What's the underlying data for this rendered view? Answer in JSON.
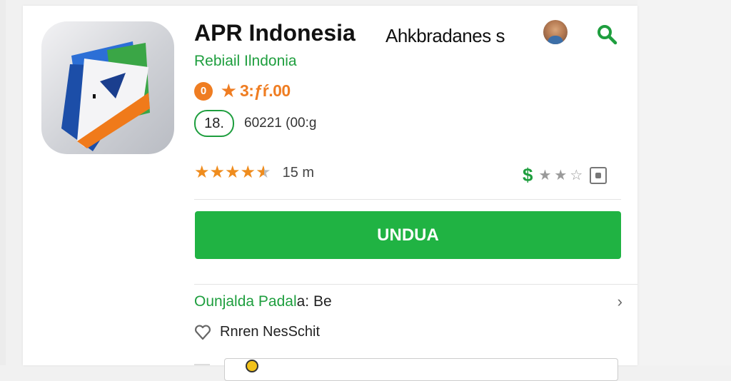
{
  "app": {
    "title": "APR Indonesia",
    "title_suffix": "Ahkbradanes s",
    "developer": "Rebiail Ilndonia",
    "rating_badge": "0",
    "rating_text": "★ 3:ƒŕ.00",
    "age_badge": "18.",
    "size_text": "60221 (00:g",
    "reviews_count": "15 m",
    "install_label": "UNDUA"
  },
  "section": {
    "title_green": "Ounjalda Padal",
    "title_dark": "a: Be",
    "info_text": "Rnren NesSchit"
  },
  "ratings": {
    "filled_stars": 4,
    "half_stars": 1,
    "secondary_stars": 3
  },
  "icons": {
    "search": "search-icon",
    "avatar": "avatar",
    "dollar": "dollar-icon",
    "flag": "report-icon",
    "chevron": "chevron-right-icon",
    "heart": "heart-icon"
  },
  "colors": {
    "accent_green": "#1e9e3e",
    "button_green": "#20b343",
    "star_orange": "#ef8c1e",
    "rating_orange": "#ef7d22"
  }
}
